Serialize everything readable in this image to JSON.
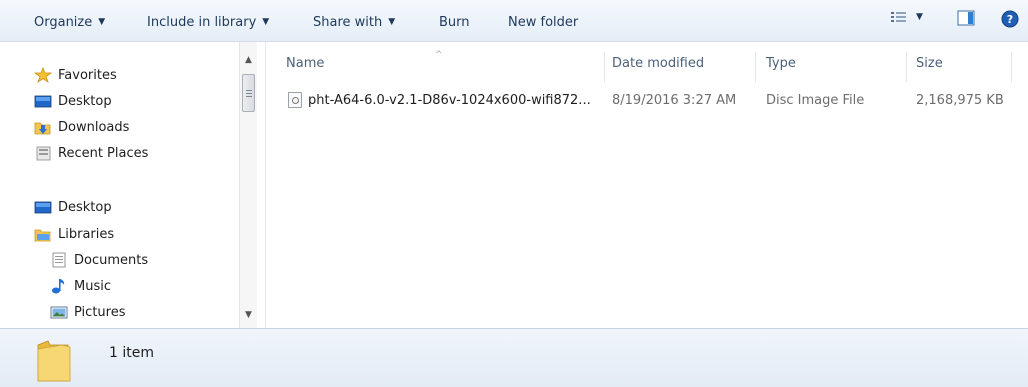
{
  "toolbar": {
    "organize": "Organize",
    "include_in_library": "Include in library",
    "share_with": "Share with",
    "burn": "Burn",
    "new_folder": "New folder",
    "view_icon": "view-options-icon",
    "preview_icon": "preview-pane-icon",
    "help_icon": "help-icon"
  },
  "nav": {
    "favorites": {
      "label": "Favorites",
      "items": [
        "Desktop",
        "Downloads",
        "Recent Places"
      ]
    },
    "desktop": "Desktop",
    "libraries": {
      "label": "Libraries",
      "items": [
        "Documents",
        "Music",
        "Pictures"
      ]
    }
  },
  "columns": {
    "name": "Name",
    "date_modified": "Date modified",
    "type": "Type",
    "size": "Size"
  },
  "files": [
    {
      "name": "pht-A64-6.0-v2.1-D86v-1024x600-wifi872...",
      "date_modified": "8/19/2016 3:27 AM",
      "type": "Disc Image File",
      "size": "2,168,975 KB"
    }
  ],
  "status": {
    "count": "1 item"
  },
  "colors": {
    "toolbar_text": "#1e395b",
    "header_text": "#4c607a",
    "folder_yellow": "#f4d46a"
  }
}
